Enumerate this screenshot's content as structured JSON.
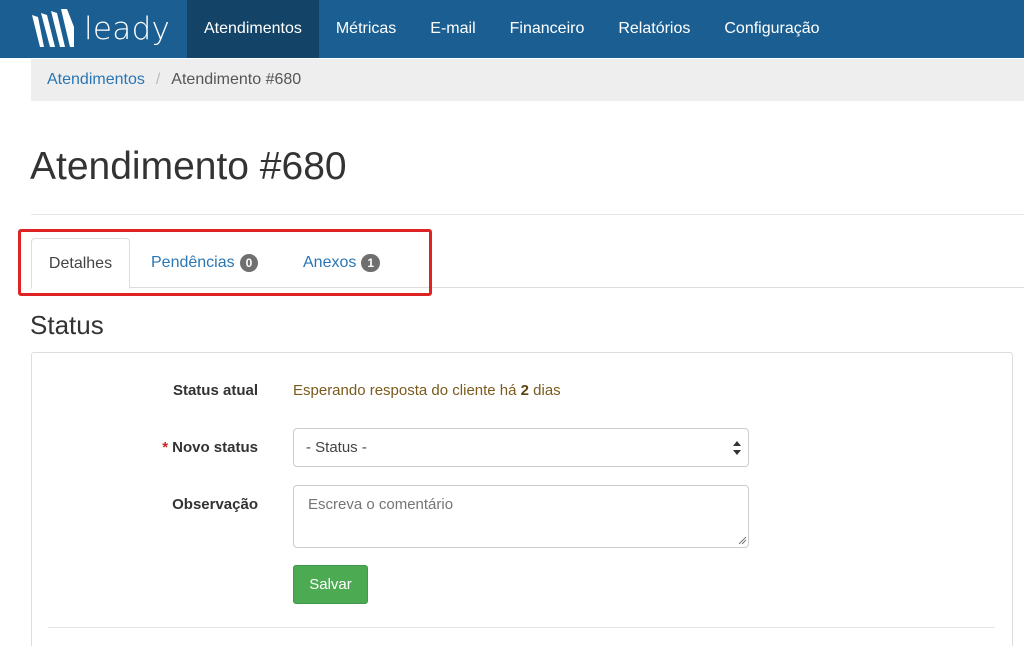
{
  "brand": {
    "name": "leady"
  },
  "nav": {
    "items": [
      {
        "label": "Atendimentos",
        "active": true
      },
      {
        "label": "Métricas"
      },
      {
        "label": "E-mail"
      },
      {
        "label": "Financeiro"
      },
      {
        "label": "Relatórios"
      },
      {
        "label": "Configuração"
      }
    ]
  },
  "breadcrumb": {
    "parent": "Atendimentos",
    "separator": "/",
    "current": "Atendimento #680"
  },
  "page": {
    "title": "Atendimento #680"
  },
  "tabs": [
    {
      "label": "Detalhes",
      "active": true
    },
    {
      "label": "Pendências",
      "badge": "0"
    },
    {
      "label": "Anexos",
      "badge": "1"
    }
  ],
  "status_section": {
    "title": "Status",
    "current_label": "Status atual",
    "current_value_prefix": "Esperando resposta do cliente há ",
    "current_value_days": "2",
    "current_value_suffix": " dias",
    "required_mark": "*",
    "new_status_label": "Novo status",
    "new_status_selected": "- Status -",
    "note_label": "Observação",
    "note_placeholder": "Escreva o comentário",
    "save_label": "Salvar"
  },
  "colors": {
    "navbar": "#1b5f92",
    "navbar_active": "#134468",
    "link": "#2a76b4",
    "save_button": "#4caa53",
    "highlight": "#dd2323"
  }
}
